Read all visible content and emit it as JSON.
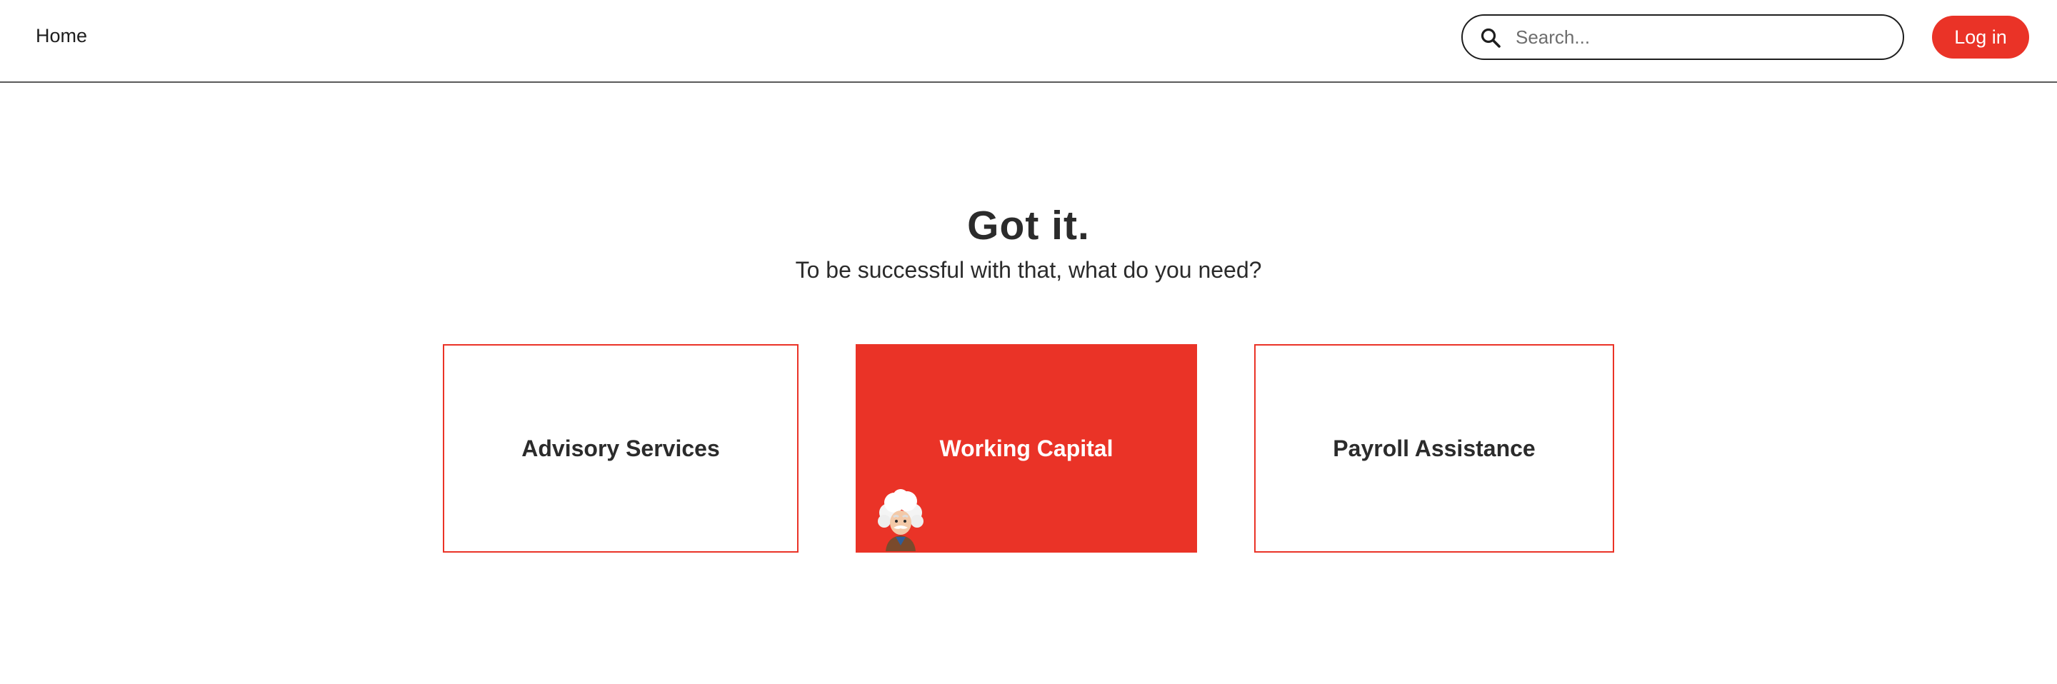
{
  "header": {
    "home_label": "Home",
    "search_placeholder": "Search...",
    "search_icon": "search-icon",
    "login_label": "Log in"
  },
  "hero": {
    "title": "Got it.",
    "subtitle": "To be successful with that, what do you need?"
  },
  "cards": [
    {
      "label": "Advisory Services",
      "selected": false
    },
    {
      "label": "Working Capital",
      "selected": true,
      "icon": "einstein-mascot-icon"
    },
    {
      "label": "Payroll Assistance",
      "selected": false
    }
  ],
  "colors": {
    "accent": "#ea3327",
    "text": "#2b2b2b",
    "divider": "#5a5a5a"
  }
}
